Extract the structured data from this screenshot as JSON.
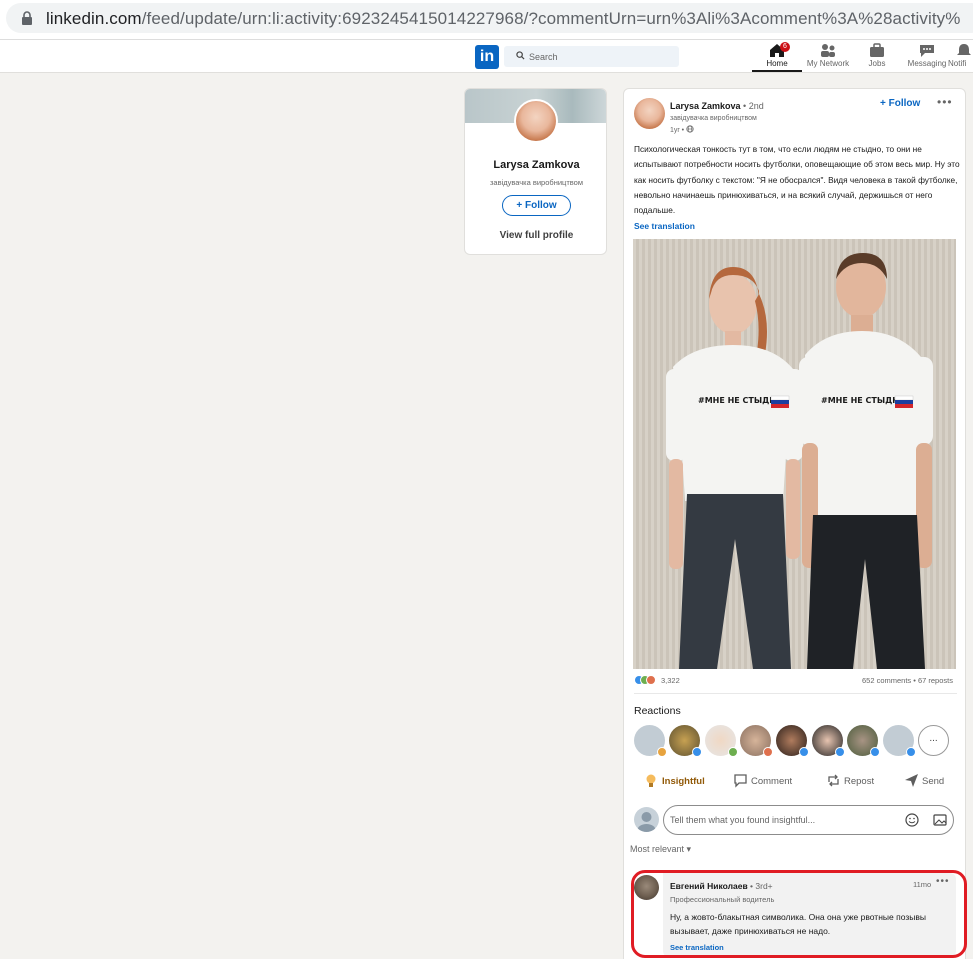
{
  "browser": {
    "url_host": "linkedin.com",
    "url_path": "/feed/update/urn:li:activity:6923245415014227968/?commentUrn=urn%3Ali%3Acomment%3A%28activity%"
  },
  "nav": {
    "logo": "in",
    "search_placeholder": "Search",
    "items": [
      {
        "label": "Home",
        "icon": "home-icon",
        "badge": "6"
      },
      {
        "label": "My Network",
        "icon": "people-icon"
      },
      {
        "label": "Jobs",
        "icon": "briefcase-icon"
      },
      {
        "label": "Messaging",
        "icon": "chat-icon"
      },
      {
        "label": "Notifi",
        "icon": "bell-icon"
      }
    ]
  },
  "profile_card": {
    "name": "Larysa Zamkova",
    "title": "завідувачка виробництвом",
    "follow_label": "+ Follow",
    "view_profile_label": "View full profile"
  },
  "post": {
    "author": "Larysa Zamkova",
    "degree": " • 2nd",
    "author_title": "завідувачка виробництвом",
    "time": "1yr •",
    "follow_label": "+ Follow",
    "more_label": "•••",
    "text": "Психологическая тонкость тут в том, что если людям не стыдно, то они не испытывают потребности носить футболки, оповещающие об этом весь мир. Ну это как носить футболку с текстом: \"Я не обосрался\". Видя человека в такой футболке, невольно начинаешь принюхиваться, и на всякий случай, держишься от него подальше.",
    "see_translation": "See translation",
    "shirt_text": "#МНЕ НЕ СТЫДНО",
    "reaction_count": "3,322",
    "stats": "652 comments • 67 reposts",
    "reactions_label": "Reactions",
    "more_reactors": "...",
    "actions": {
      "insightful": "Insightful",
      "comment": "Comment",
      "repost": "Repost",
      "send": "Send"
    },
    "comment_placeholder": "Tell them what you found insightful...",
    "sort_label": "Most relevant ▾"
  },
  "comment": {
    "name": "Евгений Николаев",
    "degree": " • 3rd+",
    "title": "Профессиональный водитель",
    "time": "11mo",
    "more_label": "•••",
    "text": "Ну, а жовто-блакытная символика. Она она уже рвотные позывы вызывает, даже принюхиваться не надо.",
    "see_translation": "See translation"
  },
  "colors": {
    "accent": "#0a66c2",
    "highlight": "#e01c24",
    "insightful": "#915907"
  }
}
